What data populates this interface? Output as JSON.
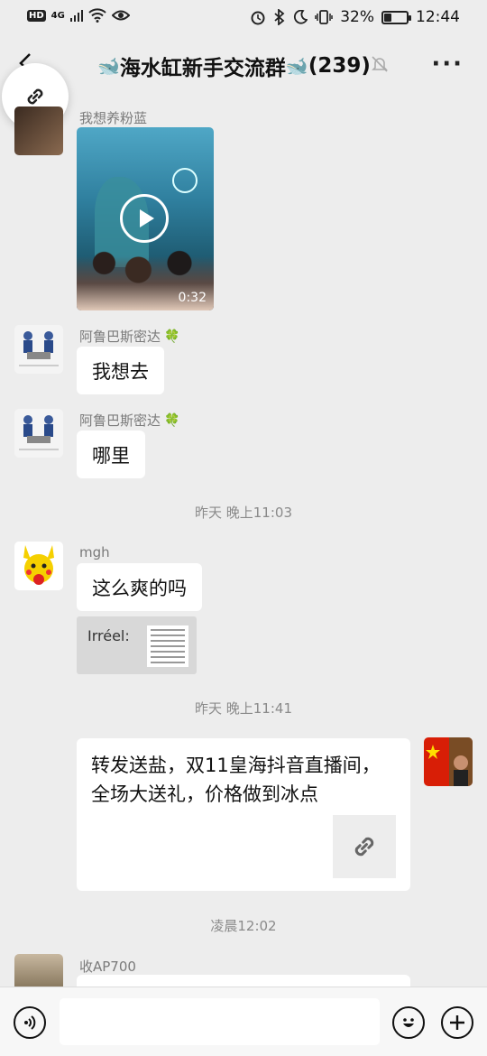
{
  "status_bar": {
    "hd": "HD",
    "network": "4G",
    "battery": "32%",
    "battery_level": 0.32,
    "time": "12:44"
  },
  "header": {
    "title": "海水缸新手交流群",
    "member_count": "(239)",
    "icons": {
      "back": "back-arrow-icon",
      "mute": "muted-bell-icon",
      "more": "more-dots-icon"
    }
  },
  "messages": [
    {
      "sender": "我想养粉蓝",
      "type": "video",
      "duration": "0:32"
    },
    {
      "sender": "阿鲁巴斯密达",
      "badge": "clover-icon",
      "text": "我想去"
    },
    {
      "sender": "阿鲁巴斯密达",
      "badge": "clover-icon",
      "text": "哪里"
    },
    {
      "timestamp": "昨天 晚上11:03"
    },
    {
      "sender": "mgh",
      "text": "这么爽的吗"
    },
    {
      "sender": "mgh",
      "type": "image",
      "caption": "Irréel:"
    },
    {
      "timestamp": "昨天 晚上11:41"
    },
    {
      "sender": "self",
      "type": "link",
      "text": "转发送盐，双11皇海抖音直播间，全场大送礼，价格做到冰点"
    },
    {
      "timestamp": "凌晨12:02"
    },
    {
      "sender": "收AP700"
    }
  ],
  "input": {
    "placeholder": ""
  },
  "colors": {
    "background": "#ededed",
    "bubble": "#ffffff",
    "clover": "#3a9e3a",
    "whale": "#4aa3e8"
  }
}
